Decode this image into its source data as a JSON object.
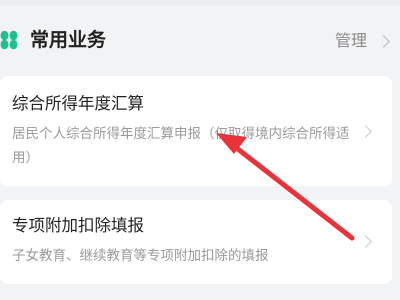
{
  "section": {
    "title": "常用业务",
    "manage_label": "管理",
    "icon": "clover-icon",
    "accent_color": "#1fbf8f"
  },
  "cards": [
    {
      "title": "综合所得年度汇算",
      "description": "居民个人综合所得年度汇算申报（仅取得境内综合所得适用）"
    },
    {
      "title": "专项附加扣除填报",
      "description": "子女教育、继续教育等专项附加扣除的填报"
    }
  ],
  "annotation": {
    "color": "#e8333a"
  }
}
